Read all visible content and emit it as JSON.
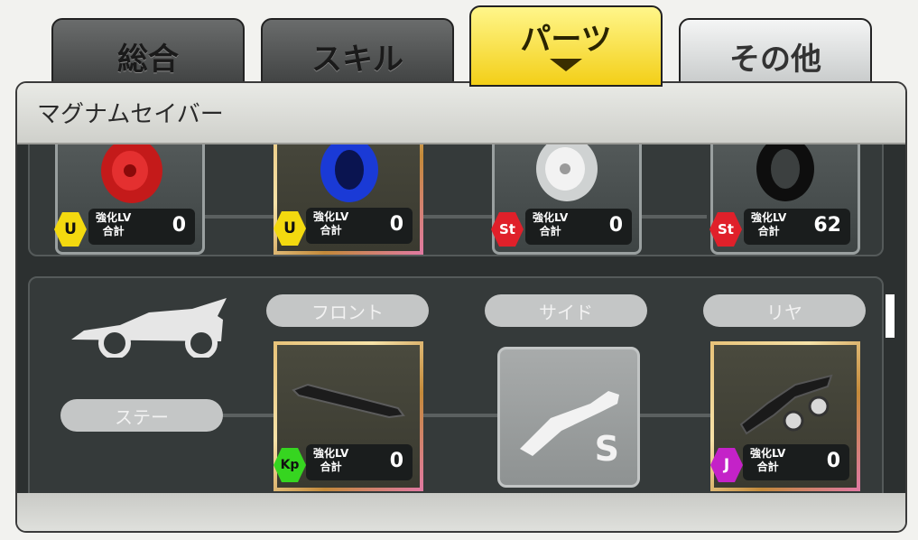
{
  "tabs": [
    {
      "label": "総合"
    },
    {
      "label": "スキル"
    },
    {
      "label": "パーツ"
    },
    {
      "label": "その他"
    }
  ],
  "panel": {
    "title": "マグナムセイバー"
  },
  "upper_slots": [
    {
      "badge": "U",
      "lv_label_1": "強化LV",
      "lv_label_2": "合計",
      "lv_value": "0",
      "part": "red-wheel"
    },
    {
      "badge": "U",
      "lv_label_1": "強化LV",
      "lv_label_2": "合計",
      "lv_value": "0",
      "part": "blue-tire"
    },
    {
      "badge": "St",
      "lv_label_1": "強化LV",
      "lv_label_2": "合計",
      "lv_value": "0",
      "part": "white-wheel"
    },
    {
      "badge": "St",
      "lv_label_1": "強化LV",
      "lv_label_2": "合計",
      "lv_value": "62",
      "part": "black-tire"
    }
  ],
  "stay_section": {
    "category_label": "ステー",
    "positions": [
      "フロント",
      "サイド",
      "リヤ"
    ],
    "slots": [
      {
        "badge": "Kp",
        "lv_label_1": "強化LV",
        "lv_label_2": "合計",
        "lv_value": "0"
      },
      {
        "disabled_letter": "S"
      },
      {
        "badge": "J",
        "lv_label_1": "強化LV",
        "lv_label_2": "合計",
        "lv_value": "0"
      }
    ]
  }
}
